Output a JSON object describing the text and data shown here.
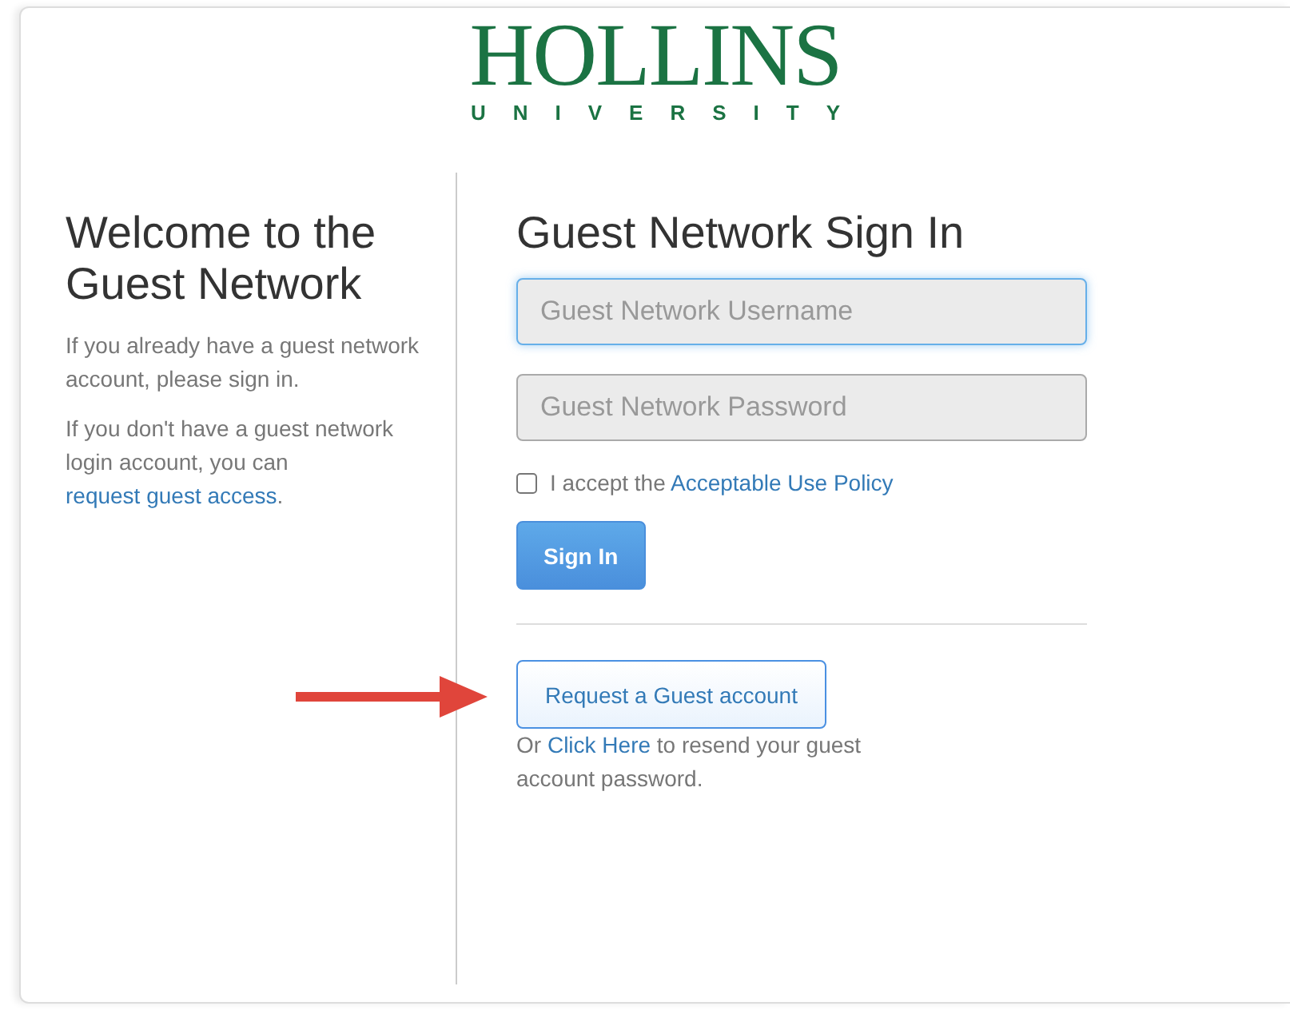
{
  "logo": {
    "name": "HOLLINS",
    "subtitle": "UNIVERSITY"
  },
  "welcome": {
    "title": "Welcome to the Guest Network",
    "paragraphs": [
      {
        "before": "If you already have a guest network account, please sign in."
      },
      {
        "before": "If you don't have a guest network login account, you can ",
        "link": "request guest access",
        "after": "."
      }
    ]
  },
  "form": {
    "title": "Guest Network Sign In",
    "fields": [
      {
        "placeholder": "Guest Network Username",
        "focused": true
      },
      {
        "placeholder": "Guest Network Password",
        "focused": false
      }
    ],
    "policy": {
      "checked": false,
      "before": "I accept the ",
      "link": "Acceptable Use Policy"
    },
    "sign_in": "Sign In",
    "request": "Request a Guest account",
    "resend": {
      "before": "Or ",
      "link": "Click Here",
      "after": " to resend your guest account password."
    }
  }
}
